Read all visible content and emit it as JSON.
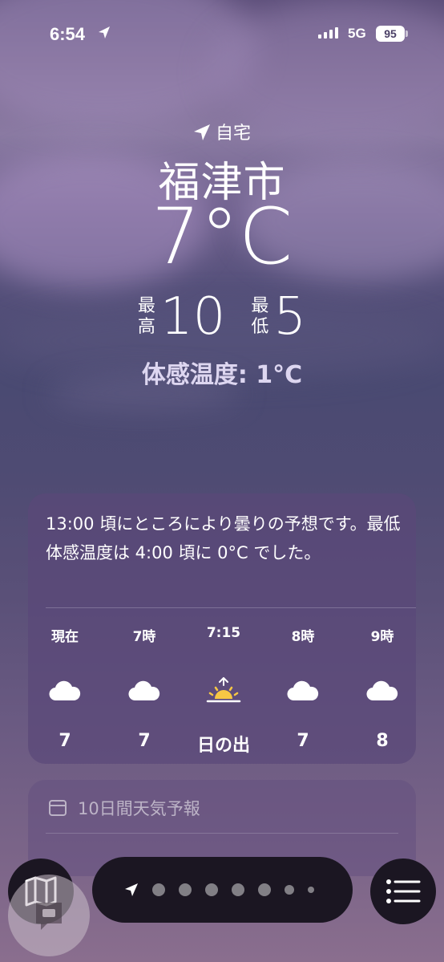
{
  "status_bar": {
    "time": "6:54",
    "network": "5G",
    "battery": "95"
  },
  "location": {
    "home_label": "自宅",
    "city": "福津市",
    "temperature": "7°C",
    "high_label_1": "最",
    "high_label_2": "高",
    "high_value": "10",
    "low_label_1": "最",
    "low_label_2": "低",
    "low_value": "5",
    "feels_like": "体感温度: 1°C"
  },
  "forecast": {
    "summary": "13:00 頃にところにより曇りの予想です。最低体感温度は 4:00 頃に 0°C でした。",
    "hours": [
      {
        "label": "現在",
        "icon": "cloud-icon",
        "temp": "7"
      },
      {
        "label": "7時",
        "icon": "cloud-icon",
        "temp": "7"
      },
      {
        "label": "7:15",
        "icon": "sunrise-icon",
        "temp": "日の出"
      },
      {
        "label": "8時",
        "icon": "cloud-icon",
        "temp": "7"
      },
      {
        "label": "9時",
        "icon": "cloud-icon",
        "temp": "8"
      }
    ]
  },
  "ten_day": {
    "title": "10日間天気予報"
  },
  "colors": {
    "sun": "#f6c744",
    "toolbar_bg": "#1b1622"
  }
}
